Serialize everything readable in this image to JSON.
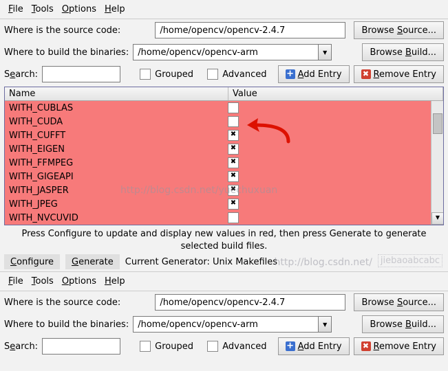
{
  "menubar": {
    "file": "File",
    "tools": "Tools",
    "options": "Options",
    "help": "Help"
  },
  "labels": {
    "where_source": "Where is the source code:",
    "where_build": "Where to build the binaries:",
    "search": "Search:",
    "grouped": "Grouped",
    "advanced": "Advanced",
    "add_entry": "Add Entry",
    "remove_entry": "Remove Entry",
    "browse_source": "Browse Source...",
    "browse_build": "Browse Build..."
  },
  "paths": {
    "source": "/home/opencv/opencv-2.4.7",
    "build": "/home/opencv/opencv-arm"
  },
  "search_value": "",
  "table": {
    "headers": {
      "name": "Name",
      "value": "Value"
    },
    "rows": [
      {
        "name": "WITH_CUBLAS",
        "checked": false
      },
      {
        "name": "WITH_CUDA",
        "checked": false
      },
      {
        "name": "WITH_CUFFT",
        "checked": true
      },
      {
        "name": "WITH_EIGEN",
        "checked": true
      },
      {
        "name": "WITH_FFMPEG",
        "checked": true
      },
      {
        "name": "WITH_GIGEAPI",
        "checked": true
      },
      {
        "name": "WITH_JASPER",
        "checked": true
      },
      {
        "name": "WITH_JPEG",
        "checked": true
      },
      {
        "name": "WITH_NVCUVID",
        "checked": false
      }
    ]
  },
  "info_line1": "Press Configure to update and display new values in red, then press Generate to generate",
  "info_line2": "selected build files.",
  "configure": "Configure",
  "generate": "Generate",
  "generator_text": "Current Generator: Unix Makefiles",
  "watermark_main": "http://blog.csdn.net/yuechuxuan",
  "watermark_small": "jiebaoabcabc",
  "watermark_sub": "http://blog.csdn.net/"
}
